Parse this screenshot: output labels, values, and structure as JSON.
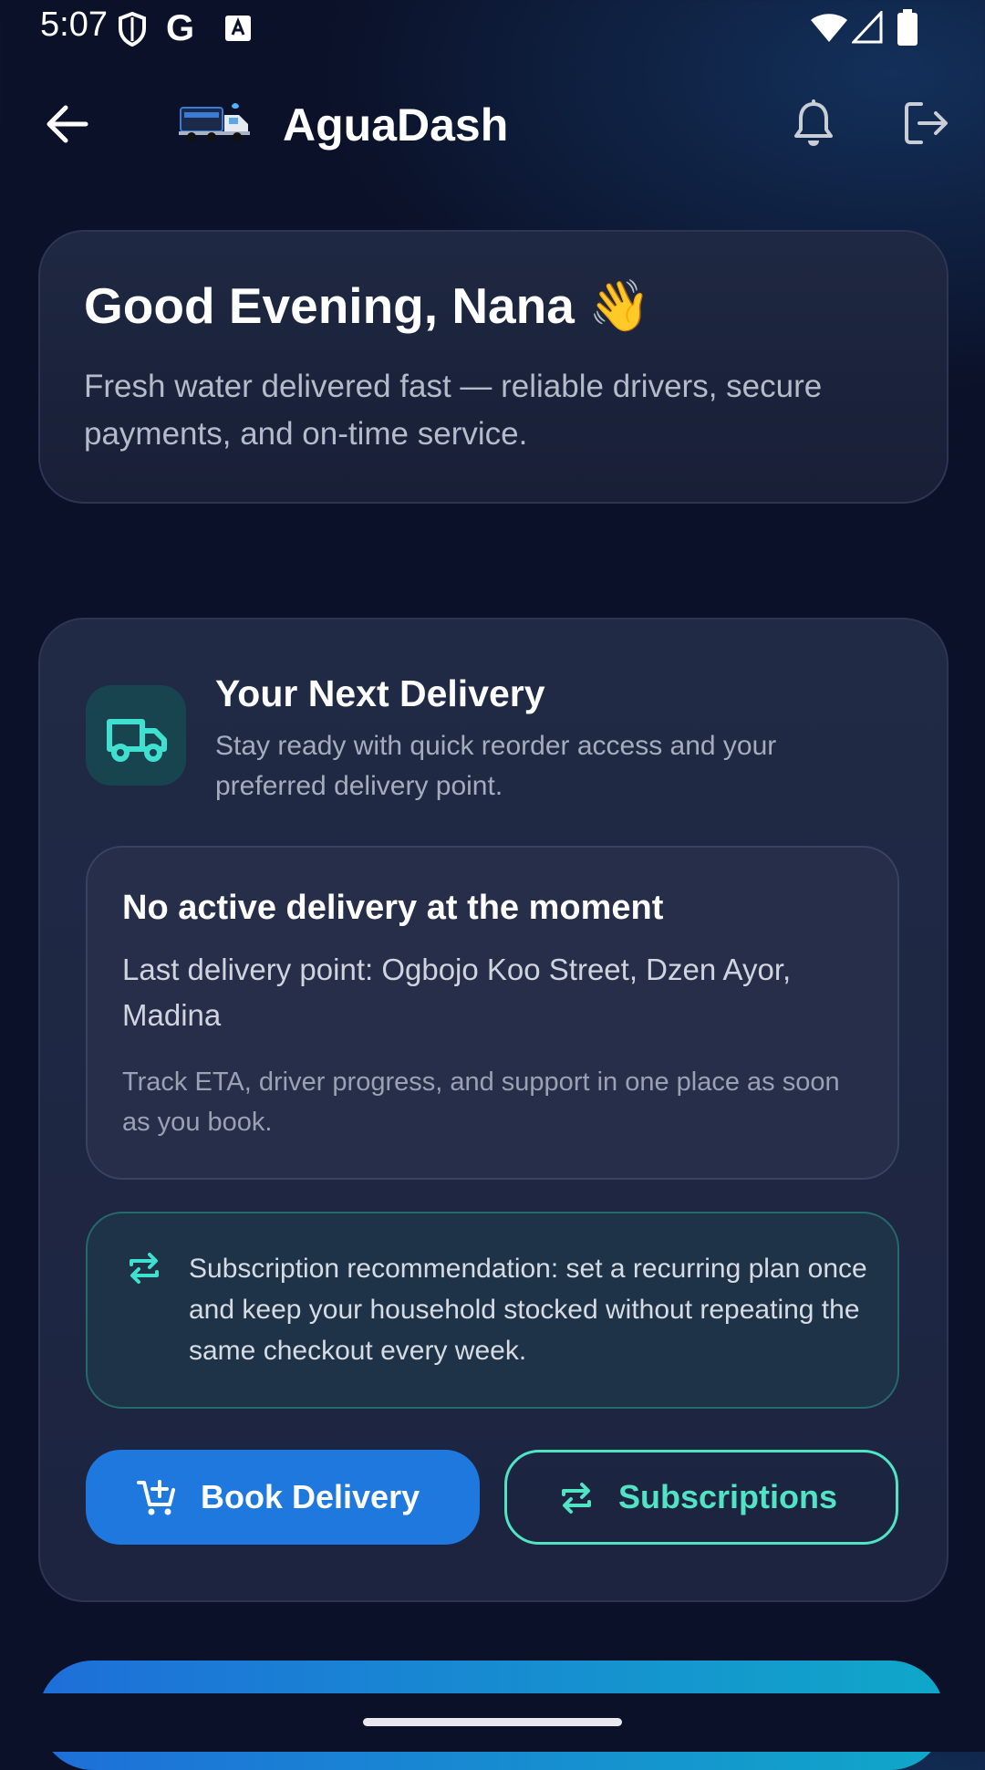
{
  "status_bar": {
    "time": "5:07",
    "left_icons": [
      "shield-icon",
      "google-icon",
      "keyboard-a-icon"
    ],
    "right_icons": [
      "wifi-icon",
      "cell-signal-icon",
      "battery-icon"
    ]
  },
  "app_bar": {
    "title": "AguaDash",
    "icons": [
      "back-arrow-icon",
      "water-truck-logo",
      "bell-icon",
      "logout-icon"
    ]
  },
  "greeting": {
    "title": "Good Evening, Nana 👋",
    "subtitle": "Fresh water delivered fast — reliable drivers, secure payments, and on-time service."
  },
  "next_delivery": {
    "title": "Your Next Delivery",
    "subtitle": "Stay ready with quick reorder access and your preferred delivery point.",
    "status": {
      "title": "No active delivery at the moment",
      "last_point": "Last delivery point: Ogbojo Koo Street, Dzen Ayor, Madina",
      "note": "Track ETA, driver progress, and support in one place as soon as you book."
    },
    "recommendation": "Subscription recommendation: set a recurring plan once and keep your household stocked without repeating the same checkout every week.",
    "buttons": {
      "book": "Book Delivery",
      "subscriptions": "Subscriptions"
    }
  },
  "colors": {
    "background": "#0b1128",
    "primary_button": "#1e78de",
    "accent_teal": "#50e3c4"
  }
}
